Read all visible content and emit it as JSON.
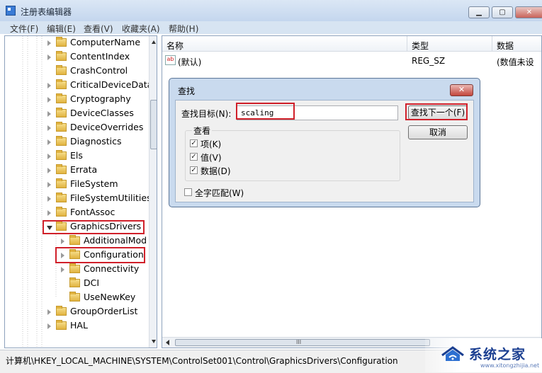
{
  "window": {
    "title": "注册表编辑器",
    "buttons": [
      "minimize",
      "maximize",
      "close"
    ]
  },
  "menu": [
    "文件(F)",
    "编辑(E)",
    "查看(V)",
    "收藏夹(A)",
    "帮助(H)"
  ],
  "tree": {
    "items": [
      {
        "label": "ComputerName",
        "expander": "collapsed",
        "level": 1
      },
      {
        "label": "ContentIndex",
        "expander": "collapsed",
        "level": 1
      },
      {
        "label": "CrashControl",
        "expander": "none",
        "level": 1
      },
      {
        "label": "CriticalDeviceData",
        "expander": "collapsed",
        "level": 1
      },
      {
        "label": "Cryptography",
        "expander": "collapsed",
        "level": 1
      },
      {
        "label": "DeviceClasses",
        "expander": "collapsed",
        "level": 1
      },
      {
        "label": "DeviceOverrides",
        "expander": "collapsed",
        "level": 1
      },
      {
        "label": "Diagnostics",
        "expander": "collapsed",
        "level": 1
      },
      {
        "label": "Els",
        "expander": "collapsed",
        "level": 1
      },
      {
        "label": "Errata",
        "expander": "collapsed",
        "level": 1
      },
      {
        "label": "FileSystem",
        "expander": "collapsed",
        "level": 1
      },
      {
        "label": "FileSystemUtilities",
        "expander": "collapsed",
        "level": 1
      },
      {
        "label": "FontAssoc",
        "expander": "collapsed",
        "level": 1
      },
      {
        "label": "GraphicsDrivers",
        "expander": "expanded",
        "level": 1,
        "highlighted": true
      },
      {
        "label": "AdditionalMod",
        "expander": "collapsed",
        "level": 2
      },
      {
        "label": "Configuration",
        "expander": "collapsed",
        "level": 2,
        "highlighted": true
      },
      {
        "label": "Connectivity",
        "expander": "collapsed",
        "level": 2
      },
      {
        "label": "DCI",
        "expander": "none",
        "level": 2
      },
      {
        "label": "UseNewKey",
        "expander": "none",
        "level": 2
      },
      {
        "label": "GroupOrderList",
        "expander": "collapsed",
        "level": 1
      },
      {
        "label": "HAL",
        "expander": "collapsed",
        "level": 1
      }
    ]
  },
  "list": {
    "columns": [
      "名称",
      "类型",
      "数据"
    ],
    "rows": [
      {
        "icon": "ab",
        "name": "(默认)",
        "type": "REG_SZ",
        "data": "(数值未设"
      }
    ]
  },
  "find_dialog": {
    "title": "查找",
    "target_label": "查找目标(N):",
    "target_value": "scaling",
    "find_next": "查找下一个(F)",
    "cancel": "取消",
    "look_at_label": "查看",
    "options": [
      {
        "label": "项(K)",
        "checked": true
      },
      {
        "label": "值(V)",
        "checked": true
      },
      {
        "label": "数据(D)",
        "checked": true
      }
    ],
    "match_whole": {
      "label": "全字匹配(W)",
      "checked": false
    }
  },
  "statusbar": {
    "path": "计算机\\HKEY_LOCAL_MACHINE\\SYSTEM\\ControlSet001\\Control\\GraphicsDrivers\\Configuration"
  },
  "watermark": {
    "text": "系统之家",
    "url": "www.xitongzhijia.net"
  },
  "colors": {
    "highlight_box": "#d0202a",
    "title_bar": "#c4d6ee",
    "dialog_frame": "#c9daee"
  }
}
